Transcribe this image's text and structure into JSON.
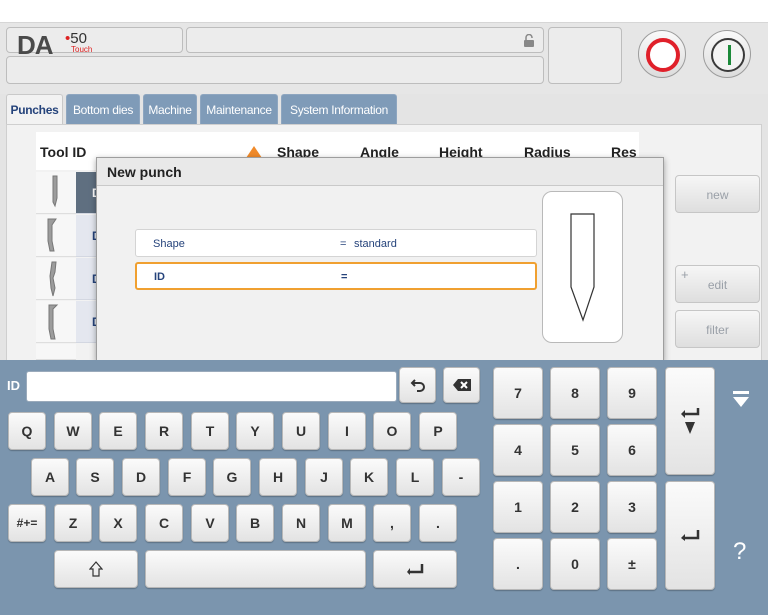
{
  "header": {
    "logo_text": "DA",
    "logo_num": "50",
    "logo_touch": "Touch",
    "lock_icon": "lock-open-icon",
    "stop_button_icon": "stop-circle-icon",
    "start_button_icon": "start-power-icon"
  },
  "tabs": [
    {
      "label": "Punches",
      "active": true
    },
    {
      "label": "Bottom dies",
      "active": false
    },
    {
      "label": "Machine",
      "active": false
    },
    {
      "label": "Maintenance",
      "active": false
    },
    {
      "label": "System Information",
      "active": false
    }
  ],
  "table": {
    "columns": [
      "Tool ID",
      "Shape",
      "Angle",
      "Height",
      "Radius",
      "Res"
    ],
    "sort_indicator_icon": "sort-up-triangle-icon",
    "row_cell_letters": [
      "D",
      "D",
      "D",
      "D"
    ]
  },
  "sidebar": {
    "new_label": "new",
    "edit_label": "edit",
    "edit_plus": "+",
    "filter_label": "filter"
  },
  "dialog": {
    "title": "New punch",
    "fields": [
      {
        "label": "Shape",
        "eq": "=",
        "value": "standard"
      },
      {
        "label": "ID",
        "eq": "=",
        "value": ""
      }
    ]
  },
  "keyboard": {
    "field_label": "ID",
    "field_value": "",
    "row1": [
      "Q",
      "W",
      "E",
      "R",
      "T",
      "Y",
      "U",
      "I",
      "O",
      "P"
    ],
    "row2": [
      "A",
      "S",
      "D",
      "F",
      "G",
      "H",
      "J",
      "K",
      "L",
      "-"
    ],
    "row3": [
      "Z",
      "X",
      "C",
      "V",
      "B",
      "N",
      "M",
      ",",
      "."
    ],
    "symbols_key": "#+=",
    "numpad": [
      "7",
      "8",
      "9",
      "4",
      "5",
      "6",
      "1",
      "2",
      "3",
      ".",
      "0",
      "±"
    ],
    "help_label": "?",
    "colors": {
      "keyboard_bg": "#7b95ae",
      "accent_orange": "#f08a2a",
      "focus_border": "#f0a030"
    }
  }
}
